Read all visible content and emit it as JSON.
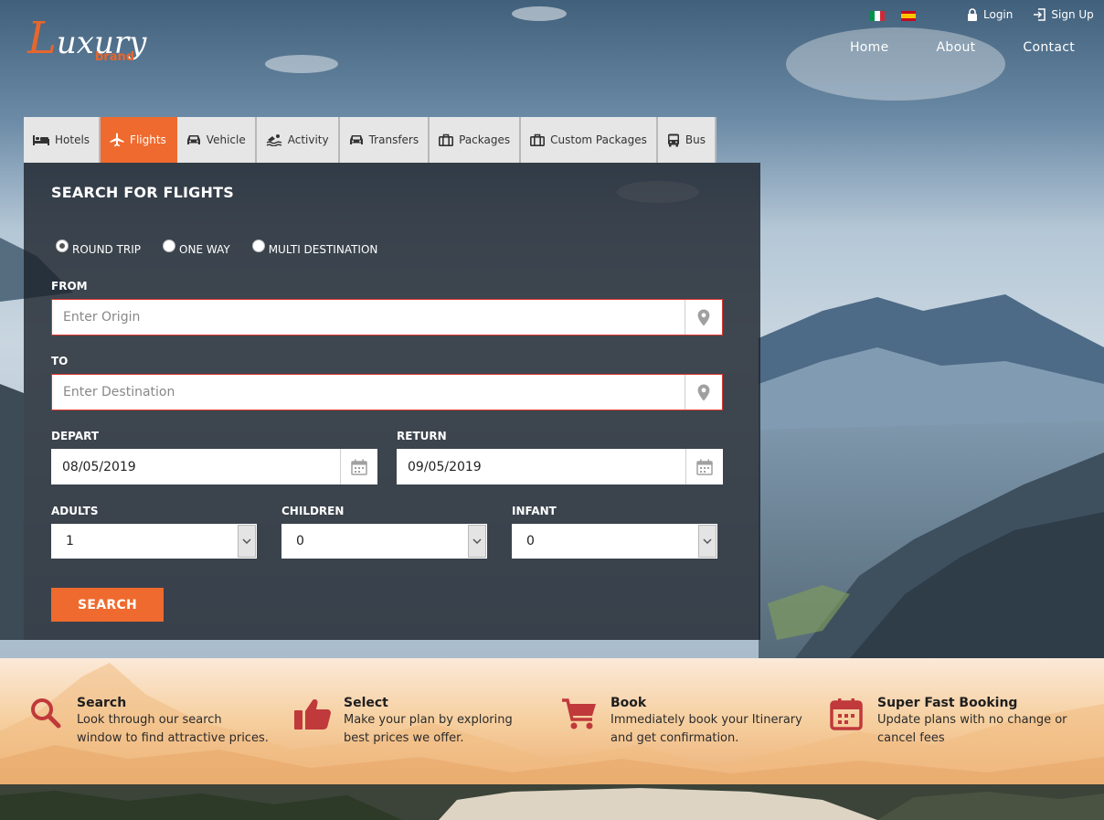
{
  "brand": {
    "logo_main": "Luxury",
    "logo_initial": "L",
    "logo_rest": "uxury",
    "logo_sub": "brand",
    "accent_color": "#ef6a2e"
  },
  "languages": [
    {
      "name": "Italiano",
      "icon": "flag-italy-icon"
    },
    {
      "name": "Español",
      "icon": "flag-spain-icon"
    }
  ],
  "auth": {
    "login_label": "Login",
    "login_icon": "lock-icon",
    "signup_label": "Sign Up",
    "signup_icon": "sign-in-icon"
  },
  "nav": {
    "home": "Home",
    "about": "About",
    "contact": "Contact"
  },
  "tabs": [
    {
      "label": "Hotels",
      "icon": "bed-icon",
      "active": false
    },
    {
      "label": "Flights",
      "icon": "plane-icon",
      "active": true
    },
    {
      "label": "Vehicle",
      "icon": "car-icon",
      "active": false
    },
    {
      "label": "Activity",
      "icon": "swimmer-icon",
      "active": false
    },
    {
      "label": "Transfers",
      "icon": "car-icon",
      "active": false
    },
    {
      "label": "Packages",
      "icon": "suitcase-icon",
      "active": false
    },
    {
      "label": "Custom Packages",
      "icon": "suitcase-icon",
      "active": false
    },
    {
      "label": "Bus",
      "icon": "bus-icon",
      "active": false
    }
  ],
  "search": {
    "title": "SEARCH FOR FLIGHTS",
    "trip_types": [
      {
        "label": "ROUND TRIP",
        "checked": true
      },
      {
        "label": "ONE WAY",
        "checked": false
      },
      {
        "label": "MULTI DESTINATION",
        "checked": false
      }
    ],
    "from_label": "FROM",
    "from_value": "",
    "from_placeholder": "Enter Origin",
    "to_label": "TO",
    "to_value": "",
    "to_placeholder": "Enter Destination",
    "depart_label": "DEPART",
    "depart_value": "08/05/2019",
    "return_label": "RETURN",
    "return_value": "09/05/2019",
    "adults_label": "ADULTS",
    "adults_value": "1",
    "children_label": "CHILDREN",
    "children_value": "0",
    "infant_label": "INFANT",
    "infant_value": "0",
    "button_label": "SEARCH",
    "error_color": "#d9372c"
  },
  "features": [
    {
      "title": "Search",
      "desc": "Look through our search window to find attractive prices.",
      "icon": "magnifier-icon"
    },
    {
      "title": "Select",
      "desc": "Make your plan by exploring best prices we offer.",
      "icon": "thumbs-up-icon"
    },
    {
      "title": "Book",
      "desc": "Immediately book your Itinerary and get confirmation.",
      "icon": "cart-icon"
    },
    {
      "title": "Super Fast Booking",
      "desc": "Update plans with no change or cancel fees",
      "icon": "calendar-icon"
    }
  ],
  "feature_icon_color": "#c0393b"
}
